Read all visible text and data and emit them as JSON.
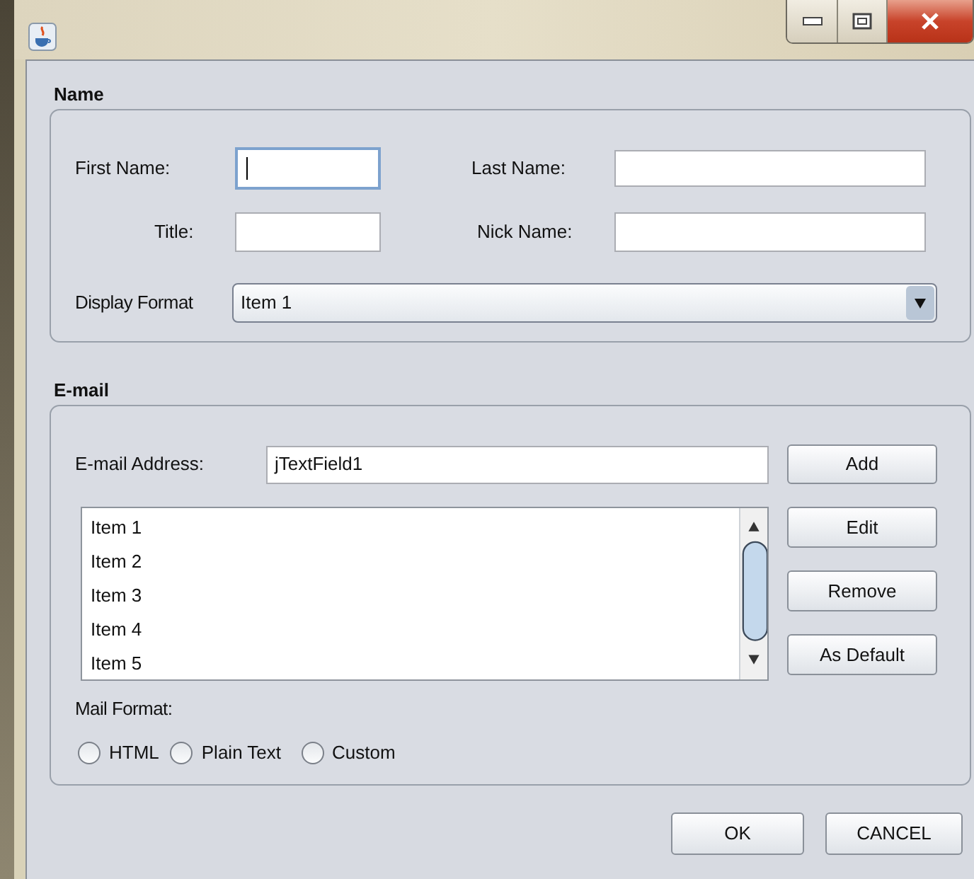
{
  "name_section": {
    "title": "Name",
    "first_name": {
      "label": "First Name:",
      "focused": true
    },
    "last_name": {
      "label": "Last Name:",
      "focused": false
    },
    "title_field": {
      "label": "Title:",
      "focused": false
    },
    "nick_name": {
      "label": "Nick Name:",
      "focused": false
    },
    "display_format": {
      "label": "Display Format",
      "value": "Item 1"
    }
  },
  "email_section": {
    "title": "E-mail",
    "address": {
      "label": "E-mail Address:",
      "value": "jTextField1"
    },
    "add_button": "Add",
    "list_items": [
      "Item 1",
      "Item 2",
      "Item 3",
      "Item 4",
      "Item 5"
    ],
    "list_buttons": [
      "Edit",
      "Remove",
      "As Default"
    ],
    "mail_format": {
      "label": "Mail Format:",
      "options": [
        {
          "label": "HTML",
          "selected": false
        },
        {
          "label": "Plain Text",
          "selected": false
        },
        {
          "label": "Custom",
          "selected": false
        }
      ]
    }
  },
  "dialog_buttons": [
    "OK",
    "CANCEL"
  ]
}
